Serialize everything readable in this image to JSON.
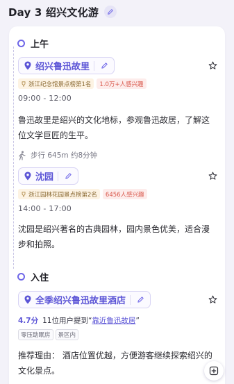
{
  "header": {
    "title": "Day 3 绍兴文化游"
  },
  "colors": {
    "accent": "#5b54d6",
    "rank_tag_text": "#8a6a33",
    "interest_tag_text": "#d9584c"
  },
  "sections": {
    "morning": {
      "title": "上午",
      "place": {
        "name": "绍兴鲁迅故里",
        "rank_tag": "浙江纪念馆景点榜第1名",
        "interest_tag": "1.0万+人感兴趣",
        "time": "09:00 - 12:00",
        "description": "鲁迅故里是绍兴的文化地标，参观鲁迅故居，了解这位文学巨匠的生平。"
      },
      "transit": {
        "icon": "walk-icon",
        "text": "步行 645m 约8分钟"
      },
      "place2": {
        "name": "沈园",
        "rank_tag": "浙江园林花园景点榜第2名",
        "interest_tag": "6456人感兴趣",
        "time": "14:00 - 17:00",
        "description": "沈园是绍兴著名的古典园林，园内景色优美，适合漫步和拍照。"
      }
    },
    "stay": {
      "title": "入住",
      "hotel": {
        "name": "全季绍兴鲁迅故里酒店",
        "rating": "4.7分",
        "mention_prefix": "11位用户提到",
        "mention_open": "“",
        "mention_link": "靠近鲁迅故居",
        "mention_close": "”",
        "tags": [
          "零压助眠房",
          "景区内"
        ],
        "recommendation": "推荐理由： 酒店位置优越，方便游客继续探索绍兴的文化景点。"
      }
    }
  }
}
